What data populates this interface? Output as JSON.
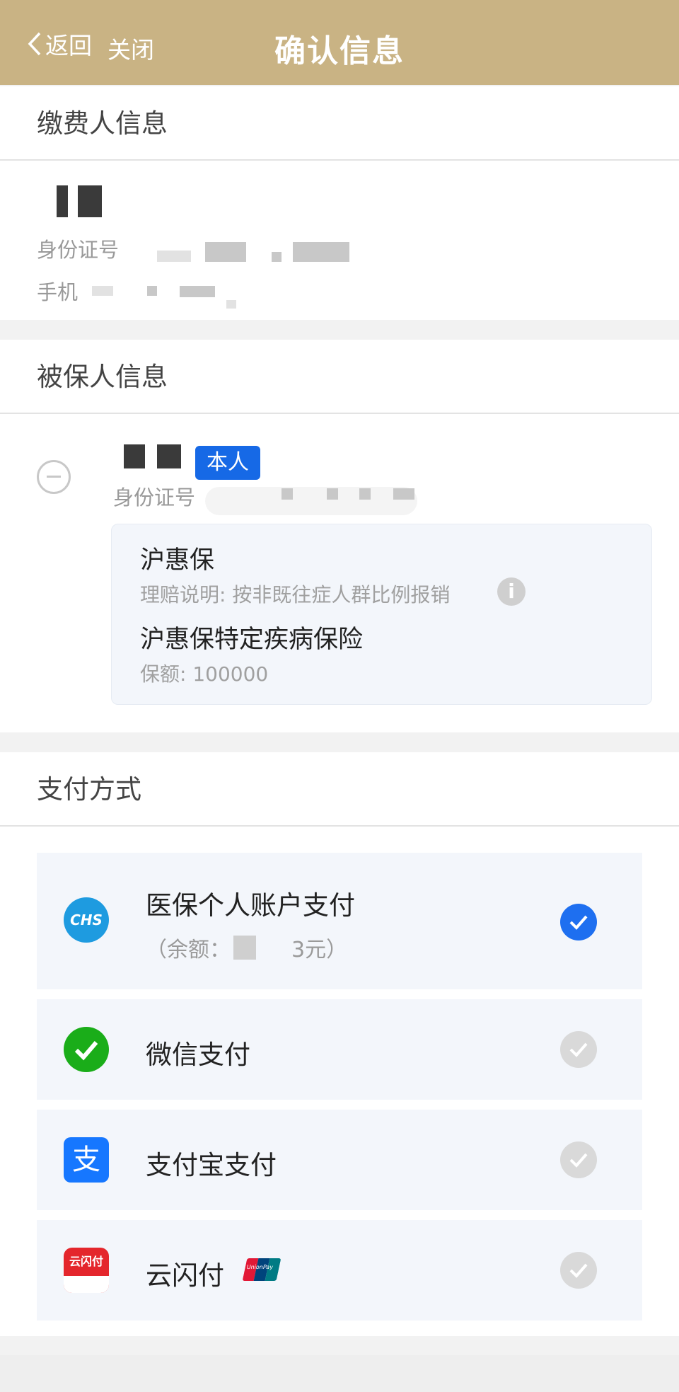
{
  "header": {
    "back_label": "返回",
    "close_label": "关闭",
    "title": "确认信息"
  },
  "payer": {
    "section_title": "缴费人信息",
    "id_label": "身份证号",
    "phone_label": "手机"
  },
  "insured": {
    "section_title": "被保人信息",
    "self_badge": "本人",
    "id_label": "身份证号",
    "plan": {
      "name": "沪惠保",
      "claim_note": "理赔说明: 按非既往症人群比例报销",
      "product": "沪惠保特定疾病保险",
      "coverage": "保额: 100000"
    }
  },
  "payment": {
    "section_title": "支付方式",
    "options": [
      {
        "label": "医保个人账户支付",
        "sub_prefix": "（余额：",
        "sub_suffix": "3元）",
        "icon": "chs-medical-insurance-icon",
        "selected": true,
        "logo_text": "CHS"
      },
      {
        "label": "微信支付",
        "icon": "wechat-pay-icon",
        "selected": false
      },
      {
        "label": "支付宝支付",
        "icon": "alipay-icon",
        "selected": false,
        "logo_text": "支"
      },
      {
        "label": "云闪付",
        "icon": "unionpay-quickpass-icon",
        "selected": false,
        "logo_text": "云闪付",
        "badge_text": "UnionPay"
      }
    ]
  },
  "colors": {
    "header_bg": "#c9b384",
    "accent_blue": "#1e6ff0",
    "self_badge_bg": "#1669e6"
  }
}
